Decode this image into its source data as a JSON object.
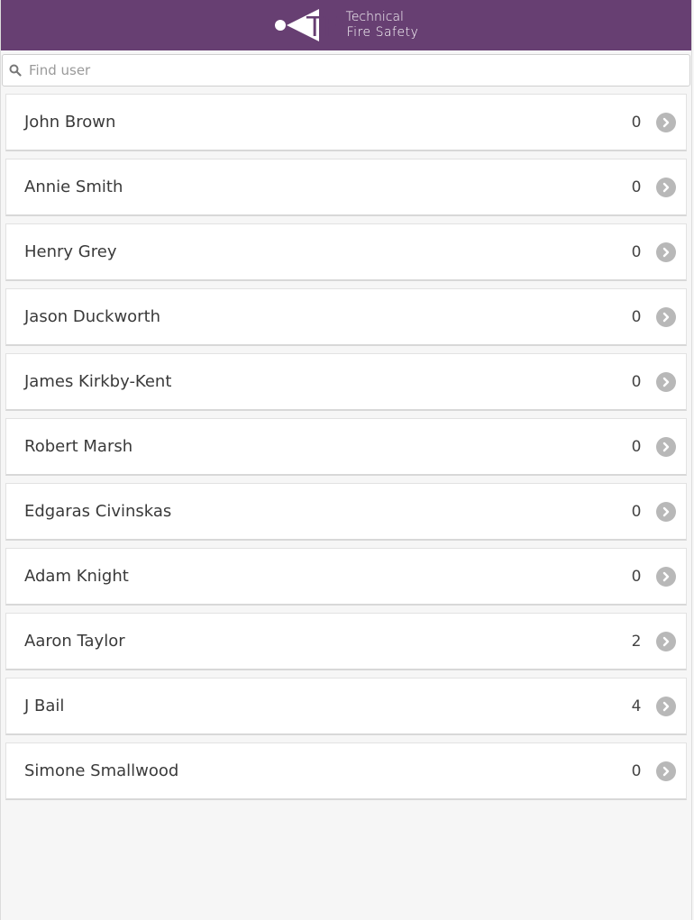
{
  "header": {
    "logo_mark": "TFS",
    "logo_line1": "Technical",
    "logo_line2": "Fire Safety",
    "background_color": "#673f72"
  },
  "search": {
    "icon": "search-icon",
    "placeholder": "Find user",
    "value": ""
  },
  "users": [
    {
      "name": "John Brown",
      "count": "0"
    },
    {
      "name": "Annie Smith",
      "count": "0"
    },
    {
      "name": "Henry Grey",
      "count": "0"
    },
    {
      "name": "Jason Duckworth",
      "count": "0"
    },
    {
      "name": "James Kirkby-Kent",
      "count": "0"
    },
    {
      "name": "Robert Marsh",
      "count": "0"
    },
    {
      "name": "Edgaras Civinskas",
      "count": "0"
    },
    {
      "name": "Adam Knight",
      "count": "0"
    },
    {
      "name": "Aaron Taylor",
      "count": "2"
    },
    {
      "name": "J Bail",
      "count": "4"
    },
    {
      "name": "Simone Smallwood",
      "count": "0"
    }
  ],
  "row_icon": "chevron-right-circle-icon"
}
